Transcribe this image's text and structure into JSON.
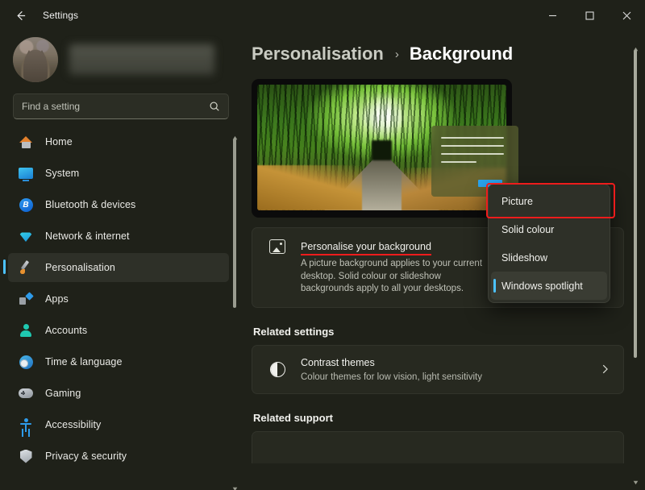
{
  "window": {
    "title": "Settings",
    "back_icon": "back-arrow-icon",
    "controls": [
      {
        "name": "minimize-button",
        "glyph": "minimize-icon"
      },
      {
        "name": "maximize-button",
        "glyph": "maximize-icon"
      },
      {
        "name": "close-button",
        "glyph": "close-icon"
      }
    ]
  },
  "sidebar": {
    "account": {
      "avatar_alt": "user-avatar-photo",
      "name_redacted": ""
    },
    "search": {
      "placeholder": "Find a setting",
      "icon": "search-icon"
    },
    "items": [
      {
        "label": "Home",
        "icon": "home-icon",
        "selected": false
      },
      {
        "label": "System",
        "icon": "system-icon",
        "selected": false
      },
      {
        "label": "Bluetooth & devices",
        "icon": "bluetooth-icon",
        "selected": false
      },
      {
        "label": "Network & internet",
        "icon": "network-icon",
        "selected": false
      },
      {
        "label": "Personalisation",
        "icon": "paintbrush-icon",
        "selected": true
      },
      {
        "label": "Apps",
        "icon": "apps-icon",
        "selected": false
      },
      {
        "label": "Accounts",
        "icon": "accounts-icon",
        "selected": false
      },
      {
        "label": "Time & language",
        "icon": "clock-icon",
        "selected": false
      },
      {
        "label": "Gaming",
        "icon": "gamepad-icon",
        "selected": false
      },
      {
        "label": "Accessibility",
        "icon": "accessibility-icon",
        "selected": false
      },
      {
        "label": "Privacy & security",
        "icon": "shield-icon",
        "selected": false
      }
    ]
  },
  "main": {
    "breadcrumb": {
      "parent": "Personalisation",
      "separator": "›",
      "current": "Background"
    },
    "preview": {
      "wallpaper_alt": "bamboo-forest-path-wallpaper",
      "overlay_alt": "sample-window-overlay"
    },
    "background_card": {
      "title": "Personalise your background",
      "description": "A picture background applies to your current desktop. Solid colour or slideshow backgrounds apply to all your desktops.",
      "icon": "picture-icon"
    },
    "related_settings": {
      "heading": "Related settings",
      "items": [
        {
          "title": "Contrast themes",
          "description": "Colour themes for low vision, light sensitivity",
          "icon": "contrast-icon",
          "chevron": "chevron-right-icon"
        }
      ]
    },
    "related_support": {
      "heading": "Related support"
    }
  },
  "dropdown": {
    "options": [
      {
        "label": "Picture",
        "selected": false,
        "highlighted": true
      },
      {
        "label": "Solid colour",
        "selected": false,
        "highlighted": false
      },
      {
        "label": "Slideshow",
        "selected": false,
        "highlighted": false
      },
      {
        "label": "Windows spotlight",
        "selected": true,
        "highlighted": false
      }
    ]
  },
  "colors": {
    "accent": "#4cc2ff",
    "annotation": "#ee1c1c",
    "window_bg": "#1f2119",
    "card_bg": "#272920"
  }
}
